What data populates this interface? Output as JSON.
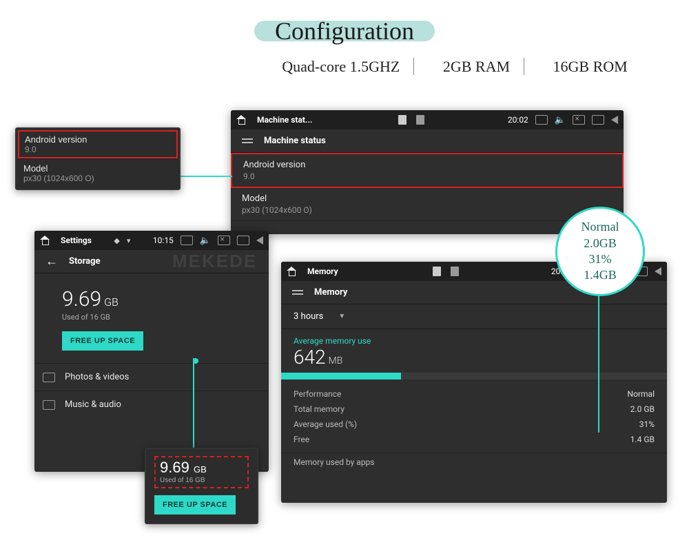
{
  "header": {
    "title": "Configuration",
    "specs": {
      "cpu": "Quad-core  1.5GHZ",
      "ram": "2GB RAM",
      "rom": "16GB ROM"
    }
  },
  "watermark": "MEKEDE",
  "machineStatus": {
    "appTitle": "Machine stat...",
    "time": "20:02",
    "subTitle": "Machine status",
    "androidVersion": {
      "label": "Android version",
      "value": "9.0"
    },
    "model": {
      "label": "Model",
      "value": "px30 (1024x600 O)"
    }
  },
  "androidZoom": {
    "label": "Android version",
    "value": "9.0",
    "modelLabel": "Model",
    "modelValue": "px30 (1024x600 O)"
  },
  "storage": {
    "appTitle": "Settings",
    "time": "10:15",
    "subTitle": "Storage",
    "used": "9.69",
    "usedUnit": "GB",
    "usedOf": "Used of 16 GB",
    "freeBtn": "FREE UP SPACE",
    "cat1": "Photos & videos",
    "cat2": "Music & audio"
  },
  "storageZoom": {
    "used": "9.69",
    "usedUnit": "GB",
    "usedOf": "Used of 16 GB",
    "freeBtn": "FREE UP SPACE"
  },
  "memory": {
    "appTitle": "Memory",
    "time": "20:02",
    "subTitle": "Memory",
    "range": "3 hours",
    "avgLabel": "Average memory use",
    "avgVal": "642",
    "avgUnit": "MB",
    "barPercent": 31,
    "rows": {
      "perf": {
        "k": "Performance",
        "v": "Normal"
      },
      "total": {
        "k": "Total memory",
        "v": "2.0 GB"
      },
      "avgPct": {
        "k": "Average used (%)",
        "v": "31%"
      },
      "free": {
        "k": "Free",
        "v": "1.4 GB"
      }
    },
    "footer": "Memory used by apps"
  },
  "memoryCallout": {
    "l1": "Normal",
    "l2": "2.0GB",
    "l3": "31%",
    "l4": "1.4GB"
  }
}
